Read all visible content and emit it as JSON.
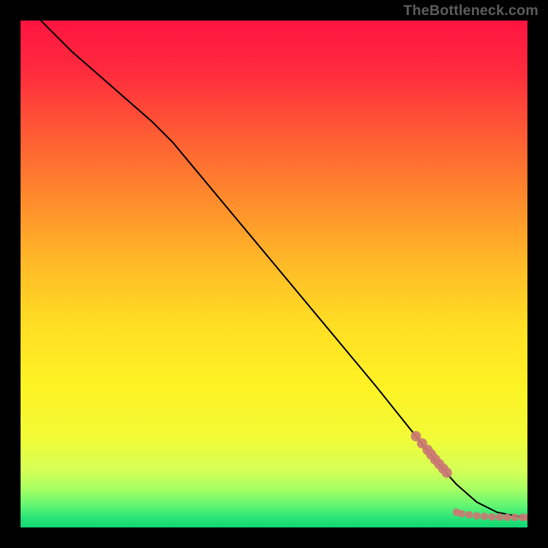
{
  "watermark": "TheBottleneck.com",
  "chart_data": {
    "type": "line",
    "title": "",
    "xlabel": "",
    "ylabel": "",
    "xlim": [
      0,
      100
    ],
    "ylim": [
      0,
      100
    ],
    "grid": false,
    "legend": false,
    "background_gradient": [
      "#ff1a3f",
      "#ff6a30",
      "#ffb52a",
      "#ffe324",
      "#fdfd2a",
      "#e3ff57",
      "#8dff6a",
      "#2ef07a",
      "#0fd872"
    ],
    "series": [
      {
        "name": "curve",
        "type": "line",
        "color": "#000000",
        "x": [
          4,
          10,
          18,
          26,
          30,
          40,
          50,
          60,
          70,
          78,
          82,
          86,
          90,
          94,
          98,
          100
        ],
        "y": [
          100,
          94,
          87,
          80,
          76,
          64,
          52,
          40,
          28,
          18,
          13,
          8.5,
          5,
          3,
          2.2,
          2.0
        ]
      },
      {
        "name": "points-cluster-a",
        "type": "scatter",
        "color": "#cb7874",
        "x": [
          78.0,
          79.2,
          80.3,
          81.0,
          81.8,
          82.6,
          83.4,
          84.1
        ],
        "y": [
          18.0,
          16.6,
          15.3,
          14.4,
          13.4,
          12.5,
          11.6,
          10.8
        ]
      },
      {
        "name": "points-cluster-b",
        "type": "scatter",
        "color": "#cb7874",
        "x": [
          86.0,
          87.0,
          88.5,
          90.0,
          91.5,
          93.0,
          94.5,
          96.0,
          97.5,
          99.0,
          100.0
        ],
        "y": [
          3.0,
          2.7,
          2.5,
          2.3,
          2.2,
          2.1,
          2.05,
          2.0,
          2.0,
          2.0,
          2.0
        ]
      }
    ]
  }
}
